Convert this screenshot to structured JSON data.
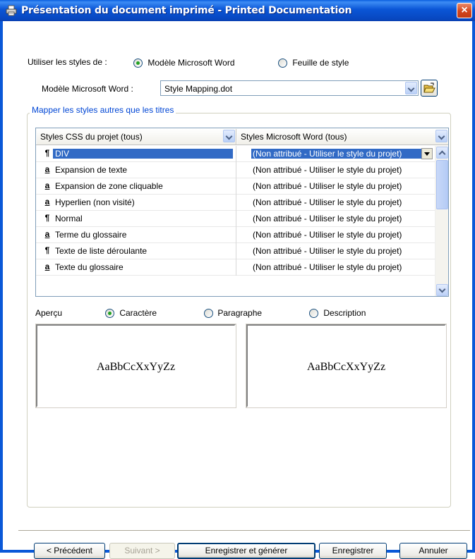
{
  "window": {
    "title": "Présentation du document imprimé - Printed Documentation",
    "close_label": "×"
  },
  "styles_source": {
    "label": "Utiliser les styles de :",
    "option_word": "Modèle Microsoft Word",
    "option_stylesheet": "Feuille de style",
    "selected": "word"
  },
  "word_template": {
    "label": "Modèle Microsoft Word :",
    "value": "Style Mapping.dot"
  },
  "mapping": {
    "group_label": "Mapper les styles autres que les titres",
    "left_filter": "Styles CSS du projet (tous)",
    "right_filter": "Styles Microsoft Word (tous)",
    "rows": [
      {
        "glyph": "¶",
        "name": "DIV",
        "value": "(Non attribué - Utiliser le style du projet)",
        "selected": true
      },
      {
        "glyph": "a",
        "name": "Expansion de texte",
        "value": "(Non attribué - Utiliser le style du projet)"
      },
      {
        "glyph": "a",
        "name": "Expansion de zone cliquable",
        "value": "(Non attribué - Utiliser le style du projet)"
      },
      {
        "glyph": "a",
        "name": "Hyperlien (non visité)",
        "value": "(Non attribué - Utiliser le style du projet)"
      },
      {
        "glyph": "¶",
        "name": "Normal",
        "value": "(Non attribué - Utiliser le style du projet)"
      },
      {
        "glyph": "a",
        "name": "Terme du glossaire",
        "value": "(Non attribué - Utiliser le style du projet)"
      },
      {
        "glyph": "¶",
        "name": "Texte de liste déroulante",
        "value": "(Non attribué - Utiliser le style du projet)"
      },
      {
        "glyph": "a",
        "name": "Texte du glossaire",
        "value": "(Non attribué - Utiliser le style du projet)"
      }
    ]
  },
  "preview": {
    "label": "Aperçu",
    "option_character": "Caractère",
    "option_paragraph": "Paragraphe",
    "option_description": "Description",
    "selected": "character",
    "sample_left": "AaBbCcXxYyZz",
    "sample_right": "AaBbCcXxYyZz"
  },
  "buttons": {
    "previous": "< Précédent",
    "next": "Suivant >",
    "save_generate": "Enregistrer et générer",
    "save": "Enregistrer",
    "cancel": "Annuler"
  },
  "colors": {
    "titlebar": "#0a55d6",
    "group_label": "#0046d5",
    "selection": "#316ac5",
    "close_button": "#d2451c"
  }
}
